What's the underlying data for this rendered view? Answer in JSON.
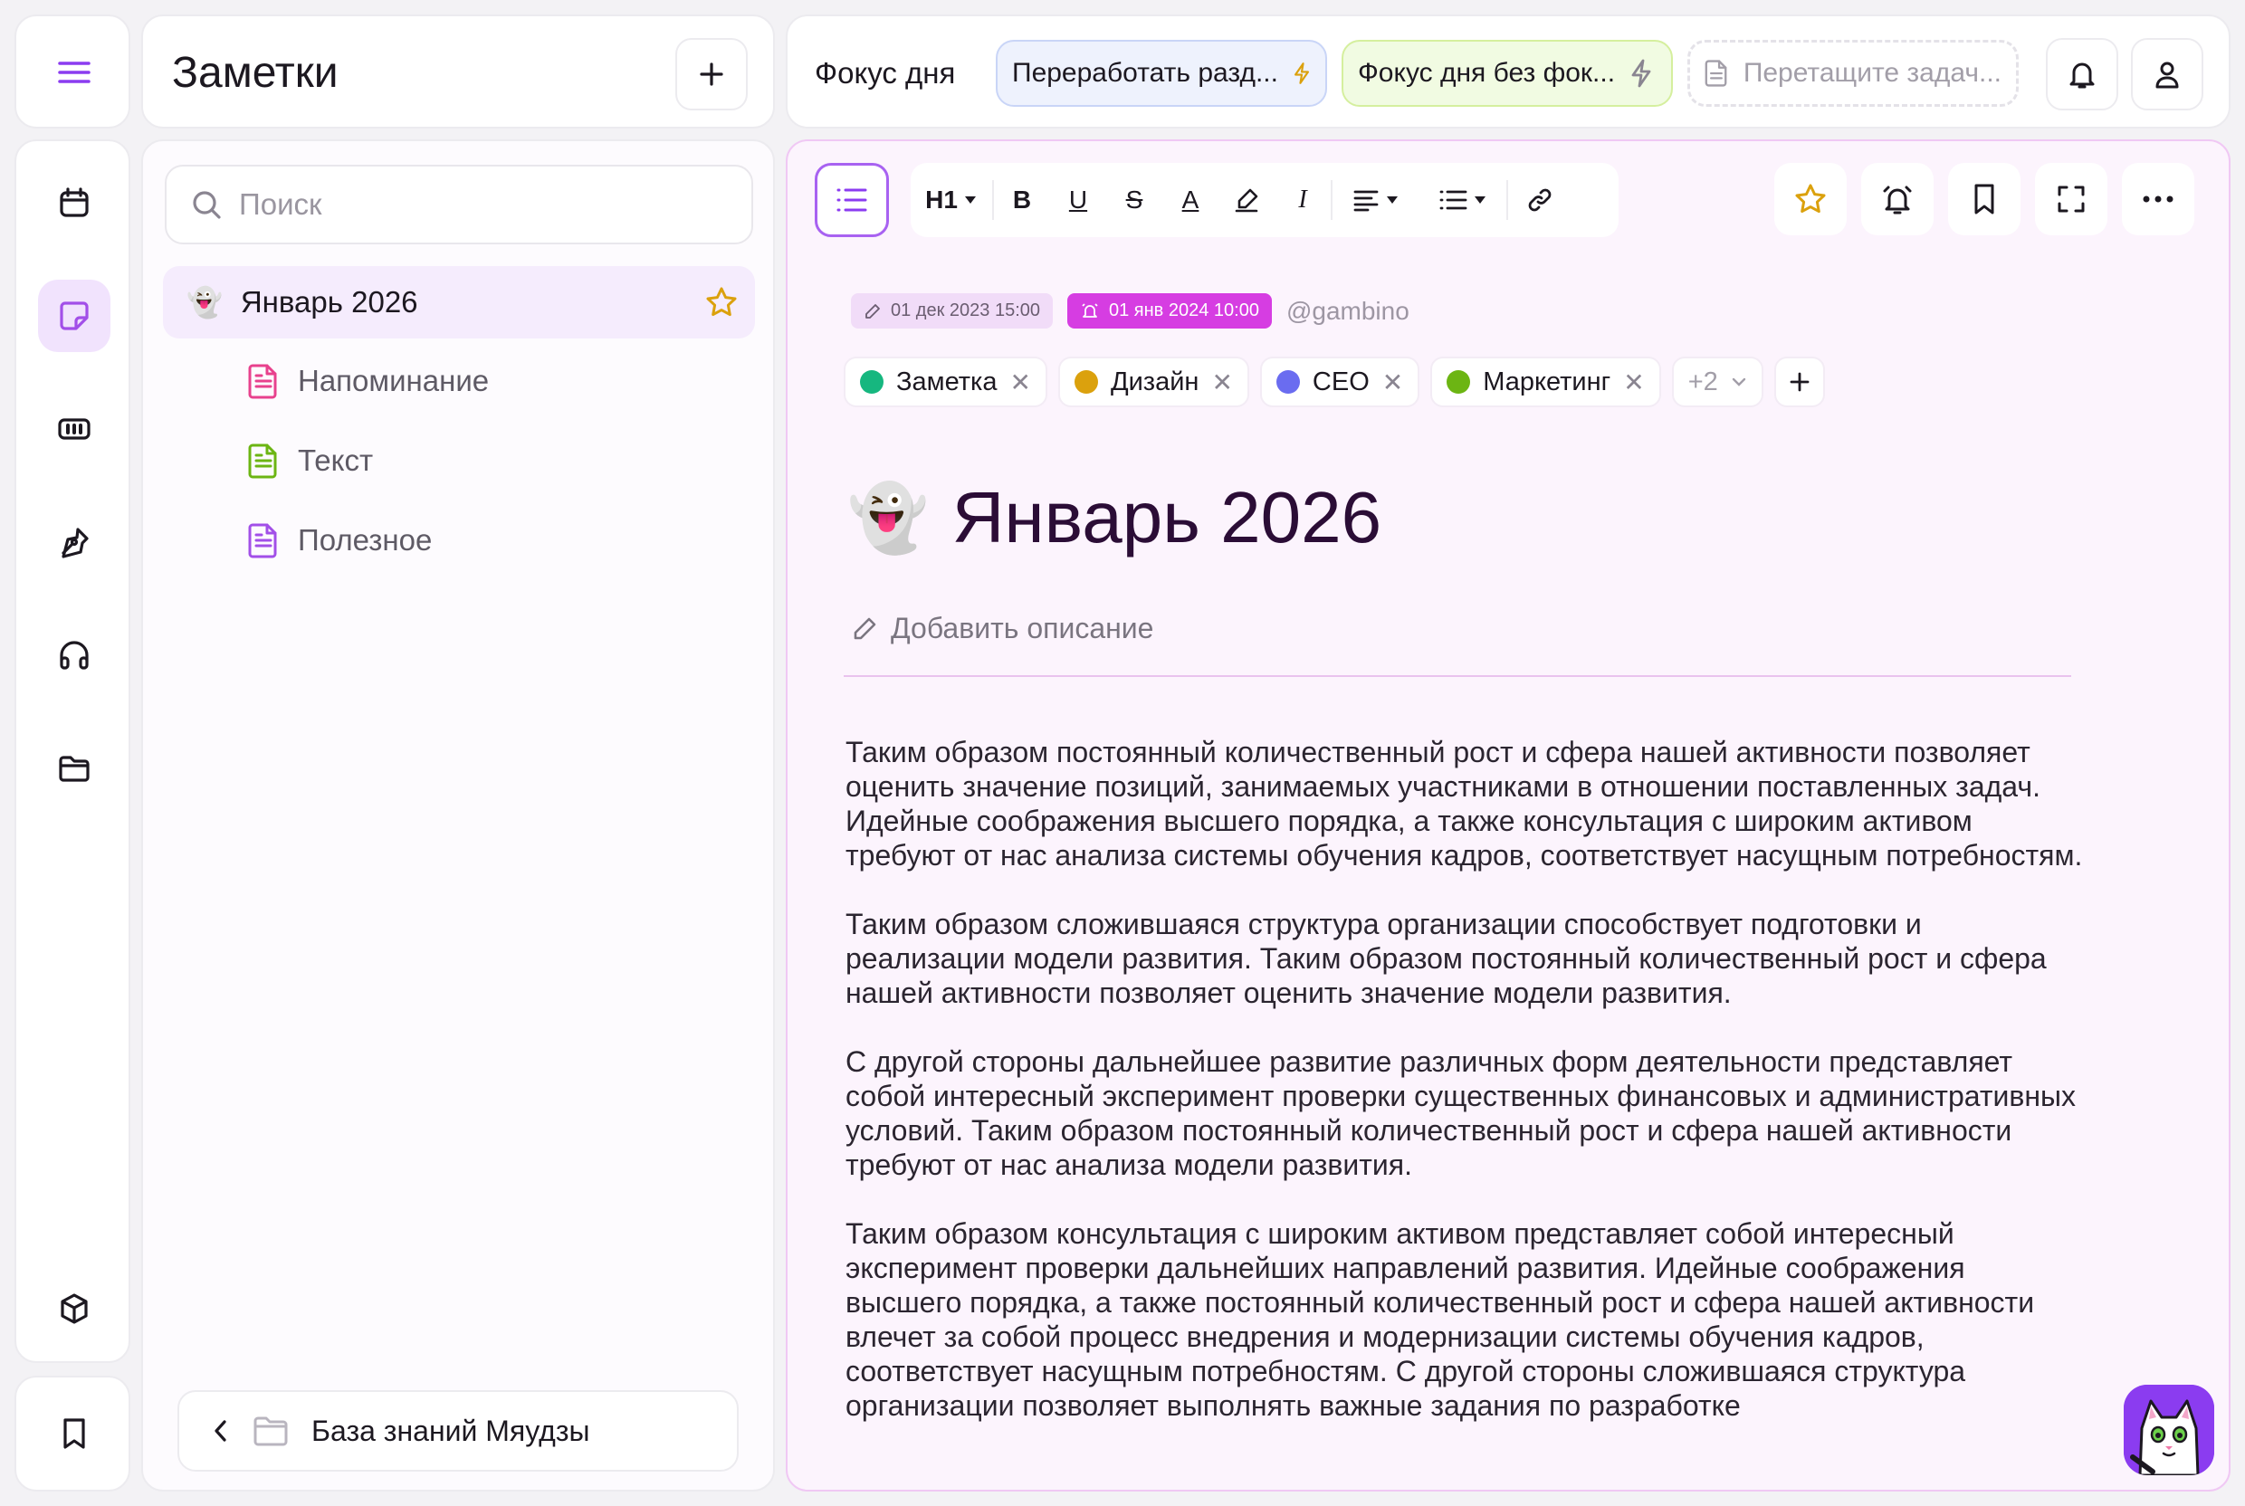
{
  "app": {
    "menu_icon": "hamburger-icon",
    "accent": "#8b3cf0"
  },
  "rail": {
    "items": [
      {
        "name": "calendar",
        "icon": "calendar-icon"
      },
      {
        "name": "notes",
        "icon": "sticky-note-icon",
        "active": true
      },
      {
        "name": "tasks",
        "icon": "ticket-icon"
      },
      {
        "name": "ideas",
        "icon": "pen-nib-icon"
      },
      {
        "name": "audio",
        "icon": "headphones-icon"
      },
      {
        "name": "files",
        "icon": "folder-icon"
      },
      {
        "name": "apps",
        "icon": "cube-icon"
      }
    ],
    "bottom_icon": "bookmark-icon"
  },
  "notes": {
    "title": "Заметки",
    "search_placeholder": "Поиск",
    "root": {
      "emoji": "👻",
      "label": "Январь 2026",
      "starred": true
    },
    "children": [
      {
        "label": "Напоминание",
        "color": "#e8418d"
      },
      {
        "label": "Текст",
        "color": "#6cb513"
      },
      {
        "label": "Полезное",
        "color": "#a24fe8"
      }
    ],
    "footer_label": "База знаний Мяудзы"
  },
  "topbar": {
    "focus_label": "Фокус дня",
    "chips": [
      {
        "label": "Переработать разд...",
        "style": "blue"
      },
      {
        "label": "Фокус дня без фок...",
        "style": "green"
      },
      {
        "label": "Перетащите задач...",
        "style": "placeholder"
      }
    ]
  },
  "toolbar": {
    "heading": "H1",
    "bold": "B",
    "underline": "U",
    "strike": "S",
    "textcolor": "A",
    "italic": "I"
  },
  "document": {
    "created": "01 дек 2023 15:00",
    "reminder": "01 янв 2024 10:00",
    "author": "@gambino",
    "tags": [
      {
        "label": "Заметка",
        "color": "#16b77f"
      },
      {
        "label": "Дизайн",
        "color": "#dba10d"
      },
      {
        "label": "CEO",
        "color": "#6a6cf0"
      },
      {
        "label": "Маркетинг",
        "color": "#6cb513"
      }
    ],
    "more_tags": "+2",
    "emoji": "👻",
    "title": "Январь 2026",
    "add_description": "Добавить описание",
    "paragraphs": [
      "Таким образом постоянный количественный рост и сфера нашей активности позволяет оценить значение позиций, занимаемых участниками в отношении поставленных задач. Идейные соображения высшего порядка, а также консультация с широким активом требуют от нас анализа системы обучения кадров, соответствует насущным потребностям.",
      "Таким образом сложившаяся структура организации способствует подготовки и реализации модели развития. Таким образом постоянный количественный рост и сфера нашей активности позволяет оценить значение модели развития.",
      "С другой стороны дальнейшее развитие различных форм деятельности представляет собой интересный эксперимент проверки существенных финансовых и административных условий. Таким образом постоянный количественный рост и сфера нашей активности требуют от нас анализа модели развития.",
      "Таким образом консультация с широким активом представляет собой интересный эксперимент проверки дальнейших направлений развития. Идейные соображения высшего порядка, а также постоянный количественный рост и сфера нашей активности влечет за собой процесс внедрения и модернизации системы обучения кадров, соответствует насущным потребностям. С другой стороны сложившаяся структура организации позволяет выполнять важные задания по разработке"
    ]
  }
}
